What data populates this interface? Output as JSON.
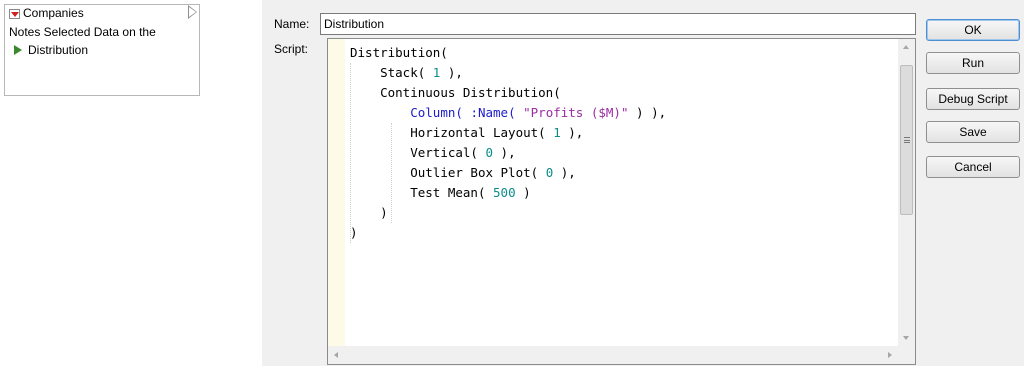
{
  "tree_panel": {
    "title": "Companies",
    "notes_line": "Notes  Selected Data on the",
    "item_label": "Distribution"
  },
  "dialog": {
    "name_label": "Name:",
    "name_value": "Distribution",
    "script_label": "Script:",
    "buttons": {
      "ok": "OK",
      "run": "Run",
      "debug": "Debug Script",
      "save": "Save",
      "cancel": "Cancel"
    }
  },
  "script": {
    "l1": "Distribution(",
    "l2_fn": "Stack(",
    "l2_num": "1",
    "l2_end": "),",
    "l3": "Continuous Distribution(",
    "l4_fn": "Column(",
    "l4_kw": ":Name(",
    "l4_str": "\"Profits ($M)\"",
    "l4_end": ") ),",
    "l5_fn": "Horizontal Layout(",
    "l5_num": "1",
    "l5_end": "),",
    "l6_fn": "Vertical(",
    "l6_num": "0",
    "l6_end": "),",
    "l7_fn": "Outlier Box Plot(",
    "l7_num": "0",
    "l7_end": "),",
    "l8_fn": "Test Mean(",
    "l8_num": "500",
    "l8_end": ")",
    "l9": ")",
    "l10": ")"
  },
  "colors": {
    "menu_arrow": "#d21f1f",
    "play_icon": "#3a8a2d",
    "gutter": "#fdfbe8",
    "function_blue": "#1c1ccd",
    "number_teal": "#0d8a8a",
    "string_purple": "#9b2ba0"
  }
}
